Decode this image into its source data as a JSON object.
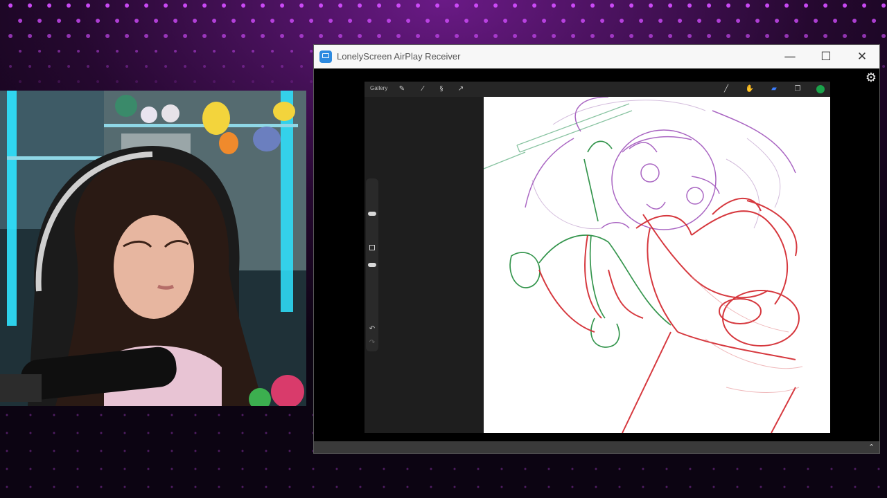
{
  "window": {
    "title": "LonelyScreen AirPlay Receiver",
    "minimize_glyph": "—",
    "maximize_glyph": "☐",
    "close_glyph": "✕",
    "settings_icon": "gear-icon"
  },
  "procreate": {
    "gallery_label": "Gallery",
    "toolbar_icons": [
      "wrench-icon",
      "magic-wand-icon",
      "selection-icon",
      "transform-icon"
    ],
    "right_tools": [
      "brush-icon",
      "smudge-icon",
      "eraser-icon",
      "layers-icon"
    ],
    "active_color": "#1aa34a"
  },
  "colors": {
    "stream_bg": "#0c0412",
    "dots": "#d24dff",
    "sketch_red": "#d2232a",
    "sketch_green": "#1f8a3a",
    "sketch_purple": "#9b4bb8"
  }
}
